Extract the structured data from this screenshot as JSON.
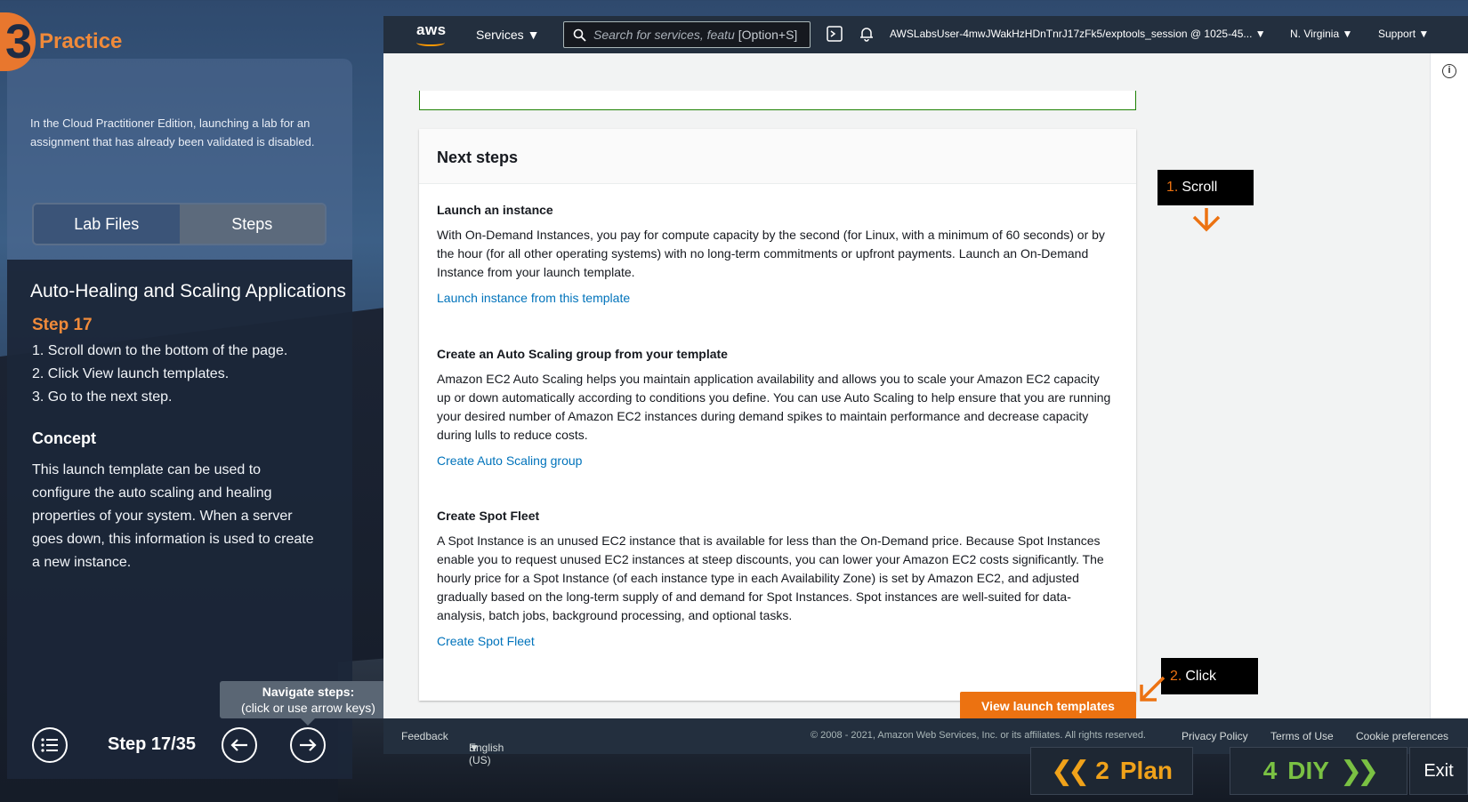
{
  "brand": {
    "number": "3",
    "label": "Practice"
  },
  "left_panel": {
    "notice": "In the Cloud Practitioner Edition, launching a lab for an assignment that has already been validated is disabled.",
    "tabs": [
      {
        "label": "Lab Files"
      },
      {
        "label": "Steps"
      }
    ],
    "lesson_title": "Auto-Healing and Scaling Applications",
    "step_heading": "Step 17",
    "steps": [
      "1. Scroll down to the bottom of the page.",
      "2. Click View launch templates.",
      "3. Go to the next step."
    ],
    "concept_heading": "Concept",
    "concept_text": "This launch template can be used to configure the auto scaling and healing properties of your system. When a server goes down, this information is used to create a new instance.",
    "tooltip_title": "Navigate steps:",
    "tooltip_text": "(click or use arrow keys)",
    "step_counter": "Step 17/35"
  },
  "aws_nav": {
    "logo": "aws",
    "services": "Services",
    "search_placeholder": "Search for services, featu",
    "search_hint": "[Option+S]",
    "account": "AWSLabsUser-4mwJWakHzHDnTnrJ17zFk5/exptools_session @ 1025-45...",
    "region": "N. Virginia",
    "support": "Support"
  },
  "card": {
    "title": "Next steps",
    "sections": [
      {
        "heading": "Launch an instance",
        "body": "With On-Demand Instances, you pay for compute capacity by the second (for Linux, with a minimum of 60 seconds) or by the hour (for all other operating systems) with no long-term commitments or upfront payments. Launch an On-Demand Instance from your launch template.",
        "link": "Launch instance from this template"
      },
      {
        "heading": "Create an Auto Scaling group from your template",
        "body": "Amazon EC2 Auto Scaling helps you maintain application availability and allows you to scale your Amazon EC2 capacity up or down automatically according to conditions you define. You can use Auto Scaling to help ensure that you are running your desired number of Amazon EC2 instances during demand spikes to maintain performance and decrease capacity during lulls to reduce costs.",
        "link": "Create Auto Scaling group"
      },
      {
        "heading": "Create Spot Fleet",
        "body": "A Spot Instance is an unused EC2 instance that is available for less than the On-Demand price. Because Spot Instances enable you to request unused EC2 instances at steep discounts, you can lower your Amazon EC2 costs significantly. The hourly price for a Spot Instance (of each instance type in each Availability Zone) is set by Amazon EC2, and adjusted gradually based on the long-term supply of and demand for Spot Instances. Spot instances are well-suited for data-analysis, batch jobs, background processing, and optional tasks.",
        "link": "Create Spot Fleet"
      }
    ]
  },
  "primary_button": "View launch templates",
  "callouts": [
    {
      "num": "1.",
      "label": "Scroll"
    },
    {
      "num": "2.",
      "label": "Click"
    }
  ],
  "footer": {
    "feedback": "Feedback",
    "language": "English (US)",
    "copyright": "© 2008 - 2021, Amazon Web Services, Inc. or its affiliates. All rights reserved.",
    "privacy": "Privacy Policy",
    "terms": "Terms of Use",
    "cookies": "Cookie preferences"
  },
  "bottom_nav": {
    "plan_num": "2",
    "plan_label": "Plan",
    "diy_num": "4",
    "diy_label": "DIY",
    "exit_label": "Exit"
  },
  "colors": {
    "accent_orange": "#ec7211",
    "aws_nav": "#232f3e",
    "link_blue": "#0073bb",
    "plan_yellow": "#f0a21a",
    "diy_green": "#7ac143"
  }
}
